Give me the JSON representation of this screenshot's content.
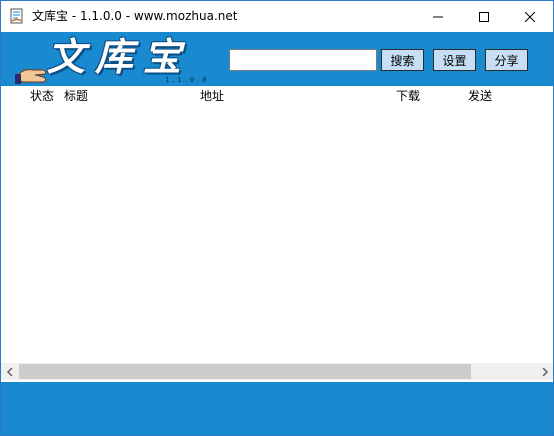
{
  "window": {
    "title": "文库宝 - 1.1.0.0 - www.mozhua.net"
  },
  "header": {
    "logo_text": "文库宝",
    "logo_version": "1.1.0.0",
    "search_value": "",
    "search_label": "搜索",
    "settings_label": "设置",
    "share_label": "分享",
    "accent_color": "#1a8ad0"
  },
  "list": {
    "columns": [
      "状态",
      "标题",
      "地址",
      "下载",
      "发送"
    ],
    "rows": []
  },
  "icons": {
    "app": "app-icon",
    "minimize": "minimize-icon",
    "maximize": "maximize-icon",
    "close": "close-icon",
    "scroll_left": "chevron-left-icon",
    "scroll_right": "chevron-right-icon"
  }
}
